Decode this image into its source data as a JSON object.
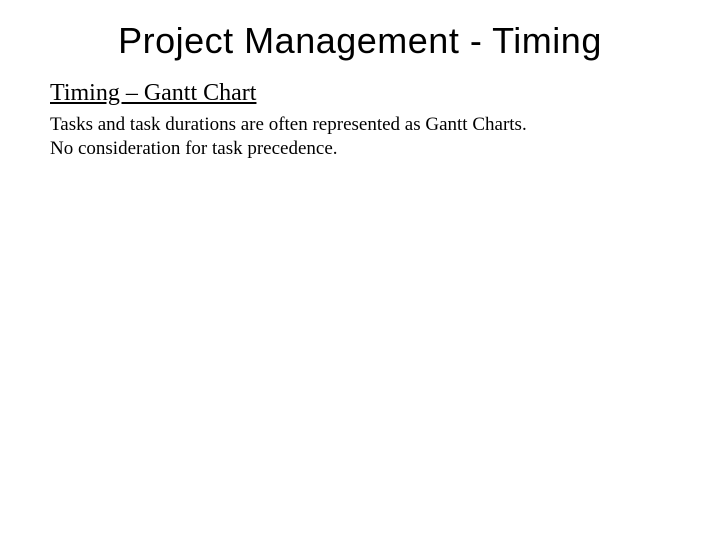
{
  "slide": {
    "title": "Project Management - Timing",
    "subtitle": "Timing – Gantt Chart",
    "body_line1": "Tasks and task durations are often represented as Gantt Charts.",
    "body_line2": "No consideration for task precedence."
  }
}
